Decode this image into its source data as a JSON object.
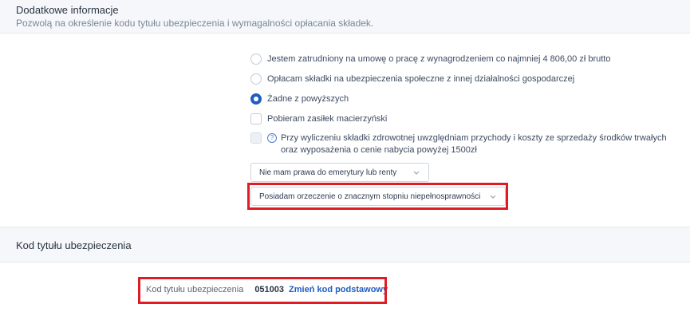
{
  "section1": {
    "title": "Dodatkowe informacje",
    "subtitle": "Pozwolą na określenie kodu tytułu ubezpieczenia i wymagalności opłacania składek."
  },
  "options": {
    "radio1": "Jestem zatrudniony na umowę o pracę z wynagrodzeniem co najmniej 4 806,00 zł brutto",
    "radio2": "Opłacam składki na ubezpieczenia społeczne z innej działalności gospodarczej",
    "radio3": "Żadne z powyższych",
    "check1": "Pobieram zasiłek macierzyński",
    "check2": "Przy wyliczeniu składki zdrowotnej uwzględniam przychody i koszty ze sprzedaży środków trwałych oraz wyposażenia o cenie nabycia powyżej 1500zł",
    "selected_radio": "radio3"
  },
  "selects": {
    "pension": "Nie mam prawa do emerytury lub renty",
    "disability": "Posiadam orzeczenie o znacznym stopniu niepełnosprawności"
  },
  "section2": {
    "title": "Kod tytułu ubezpieczenia"
  },
  "kod": {
    "label": "Kod tytułu ubezpieczenia",
    "value": "051003",
    "link": "Zmień kod podstawowy"
  },
  "colors": {
    "accent": "#1f5dc3",
    "highlight": "#e01b24"
  }
}
